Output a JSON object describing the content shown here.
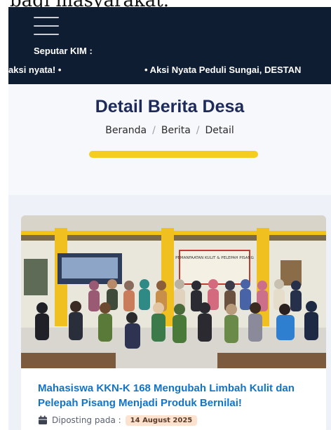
{
  "top_cutoff_text": "bagi masyarakat.",
  "navbar": {
    "menu_icon": "hamburger-menu-icon",
    "news_label": "Seputar KIM :",
    "ticker_items": [
      "aksi nyata! •",
      "• Aksi Nyata Peduli Sungai, DESTAN"
    ]
  },
  "hero": {
    "title": "Detail Berita Desa",
    "breadcrumb": [
      "Beranda",
      "Berita",
      "Detail"
    ],
    "accent_color": "#f5cd21"
  },
  "article": {
    "title": "Mahasiswa KKN-K 168 Mengubah Limbah Kulit dan Pelepah Pisang Menjadi Produk Bernilai!",
    "posted_label": "Diposting pada :",
    "date": "14 August 2025",
    "calendar_icon": "calendar-icon",
    "banner_text": "PEMANFAATAN KULIT & PELEPAH PISANG",
    "title_color": "#1273c8"
  },
  "colors": {
    "navbar_bg": "#0f1d33",
    "hero_title": "#1d2a5a",
    "content_bg": "#eef1f8"
  }
}
